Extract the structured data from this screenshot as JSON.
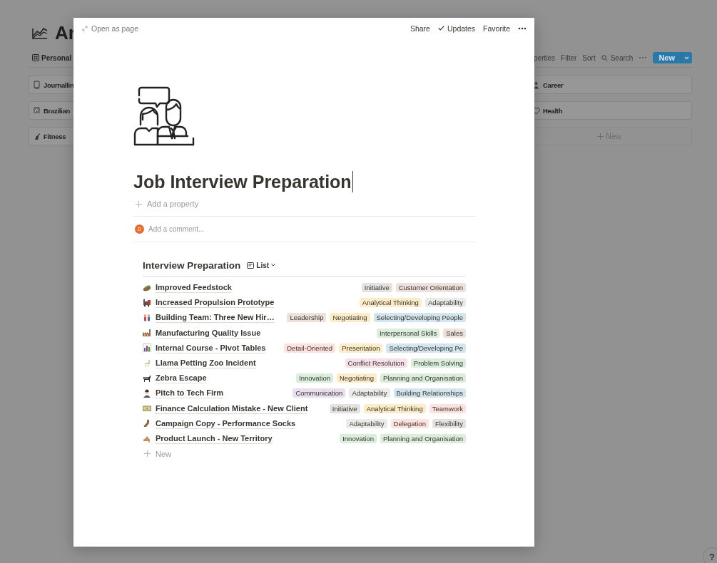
{
  "backdrop": {
    "title": "Ar",
    "view_tab": "Personal",
    "toolbar": [
      "perties",
      "Filter",
      "Sort"
    ],
    "search": "Search",
    "new_button": "New",
    "left_cards": [
      "Journallin",
      "Brazilian",
      "Fitness"
    ],
    "right_cards": [
      "Career",
      "Health"
    ],
    "add_card": "New",
    "help": "?"
  },
  "modal": {
    "open_as_page": "Open as page",
    "actions": [
      {
        "kind": "text",
        "label": "Share"
      },
      {
        "kind": "check",
        "label": "Updates"
      },
      {
        "kind": "text",
        "label": "Favorite"
      }
    ],
    "page": {
      "title": "Job Interview Preparation",
      "add_property": "Add a property",
      "comment": {
        "avatar": "D",
        "placeholder": "Add a comment..."
      },
      "database": {
        "title": "Interview Preparation",
        "view": "List",
        "rows": [
          {
            "title": "Improved Feedstock",
            "tags": [
              {
                "label": "Initiative",
                "color": "#e3e2e0"
              },
              {
                "label": "Customer Orientation",
                "color": "#eee0da"
              }
            ]
          },
          {
            "title": "Increased Propulsion Prototype",
            "tags": [
              {
                "label": "Analytical Thinking",
                "color": "#fdecc8"
              },
              {
                "label": "Adaptability",
                "color": "#ebebea"
              }
            ]
          },
          {
            "title": "Building Team: Three New Hir…",
            "tags": [
              {
                "label": "Leadership",
                "color": "#eee0da"
              },
              {
                "label": "Negotiating",
                "color": "#fdecc8"
              },
              {
                "label": "Selecting/Developing People",
                "color": "#d3e5ef"
              }
            ]
          },
          {
            "title": "Manufacturing Quality Issue",
            "tags": [
              {
                "label": "Interpersonal Skills",
                "color": "#dbeddb"
              },
              {
                "label": "Sales",
                "color": "#eee0da"
              }
            ]
          },
          {
            "title": "Internal Course - Pivot Tables",
            "tags": [
              {
                "label": "Detail-Oriented",
                "color": "#ffe2dd"
              },
              {
                "label": "Presentation",
                "color": "#fdecc8"
              },
              {
                "label": "Selecting/Developing Pe",
                "color": "#d3e5ef"
              }
            ]
          },
          {
            "title": "Llama Petting Zoo Incident",
            "tags": [
              {
                "label": "Conflict Resolution",
                "color": "#f5e0e9"
              },
              {
                "label": "Problem Solving",
                "color": "#dbeddb"
              }
            ]
          },
          {
            "title": "Zebra Escape",
            "tags": [
              {
                "label": "Innovation",
                "color": "#dbeddb"
              },
              {
                "label": "Negotiating",
                "color": "#fdecc8"
              },
              {
                "label": "Planning and Organisation",
                "color": "#dbeddb"
              }
            ]
          },
          {
            "title": "Pitch to Tech Firm",
            "tags": [
              {
                "label": "Communication",
                "color": "#e8deee"
              },
              {
                "label": "Adaptability",
                "color": "#ebebea"
              },
              {
                "label": "Building Relationships",
                "color": "#d3e5ef"
              }
            ]
          },
          {
            "title": "Finance Calculation Mistake - New Client",
            "tags": [
              {
                "label": "Initiative",
                "color": "#e3e2e0"
              },
              {
                "label": "Analytical Thinking",
                "color": "#fdecc8"
              },
              {
                "label": "Teamwork",
                "color": "#ffe2dd"
              }
            ]
          },
          {
            "title": "Campaign Copy - Performance Socks",
            "tags": [
              {
                "label": "Adaptability",
                "color": "#ebebea"
              },
              {
                "label": "Delegation",
                "color": "#ffe2dd"
              },
              {
                "label": "Flexibility",
                "color": "#e3e2e0"
              }
            ]
          },
          {
            "title": "Product Launch - New Territory",
            "tags": [
              {
                "label": "Innovation",
                "color": "#dbeddb"
              },
              {
                "label": "Planning and Organisation",
                "color": "#dbeddb"
              }
            ]
          }
        ],
        "new_row": "New"
      }
    }
  }
}
